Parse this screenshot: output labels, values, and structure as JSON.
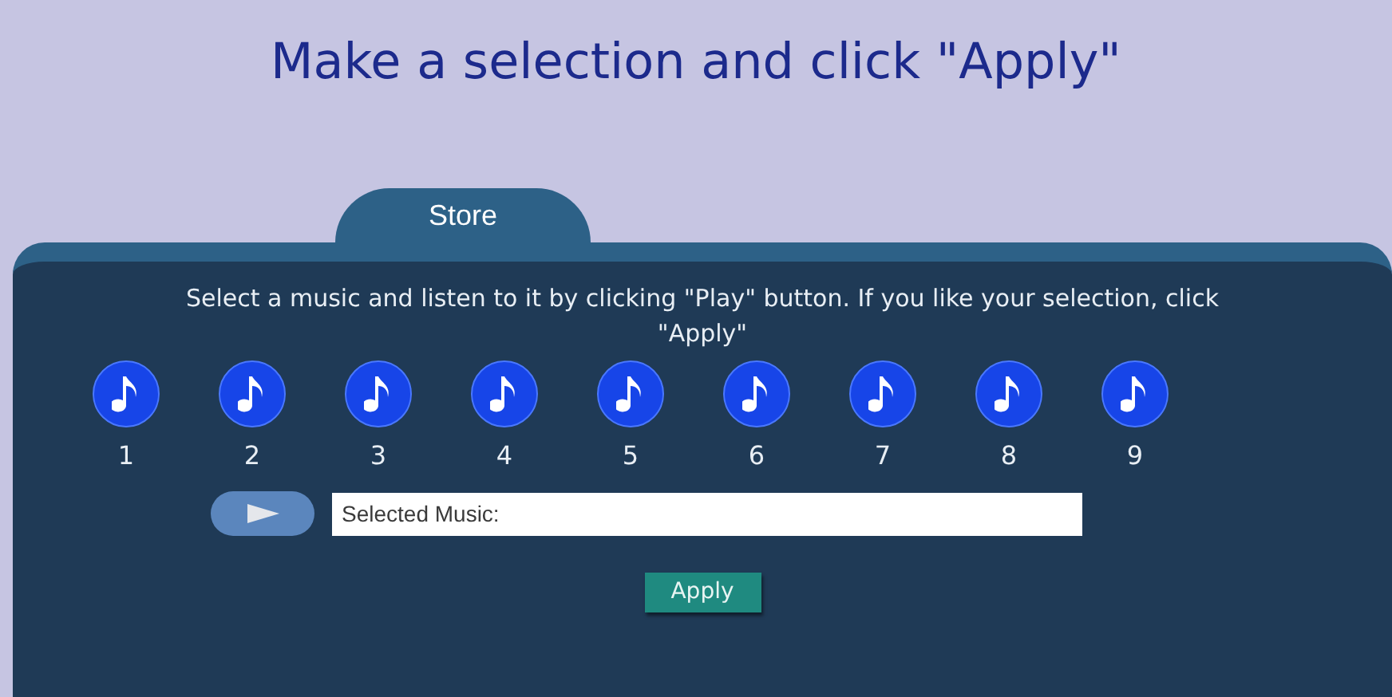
{
  "title": "Make a selection and click \"Apply\"",
  "tabs": [
    {
      "label": "Store",
      "selected": true
    }
  ],
  "instructions": "Select a music and listen to it by clicking \"Play\" button. If you  like your selection, click \"Apply\"",
  "tracks": [
    {
      "number": "1",
      "selected": false
    },
    {
      "number": "2",
      "selected": false
    },
    {
      "number": "3",
      "selected": false
    },
    {
      "number": "4",
      "selected": false
    },
    {
      "number": "5",
      "selected": false
    },
    {
      "number": "6",
      "selected": false
    },
    {
      "number": "7",
      "selected": false
    },
    {
      "number": "8",
      "selected": false
    },
    {
      "number": "9",
      "selected": false
    }
  ],
  "selected_music_field": {
    "value": "Selected Music:"
  },
  "apply_button": "Apply"
}
